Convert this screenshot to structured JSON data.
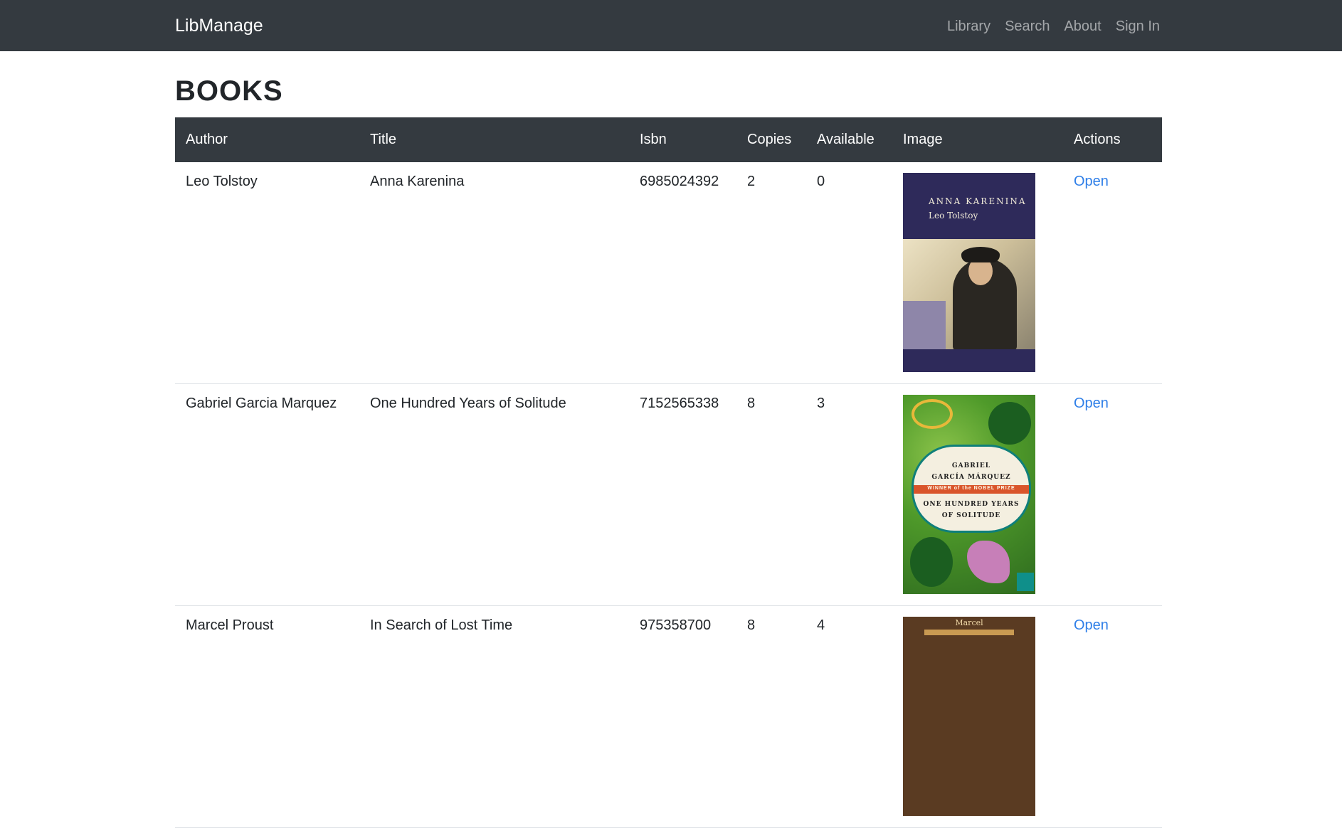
{
  "navbar": {
    "brand": "LibManage",
    "links": [
      "Library",
      "Search",
      "About",
      "Sign In"
    ]
  },
  "page": {
    "title": "BOOKS"
  },
  "table": {
    "headers": [
      "Author",
      "Title",
      "Isbn",
      "Copies",
      "Available",
      "Image",
      "Actions"
    ],
    "rows": [
      {
        "author": "Leo Tolstoy",
        "title": "Anna Karenina",
        "isbn": "6985024392",
        "copies": "2",
        "available": "0",
        "cover": {
          "title": "ANNA KARENINA",
          "author": "Leo Tolstoy"
        },
        "action": "Open"
      },
      {
        "author": "Gabriel Garcia Marquez",
        "title": "One Hundred Years of Solitude",
        "isbn": "7152565338",
        "copies": "8",
        "available": "3",
        "cover": {
          "line1": "GABRIEL",
          "line2": "GARCÍA MÁRQUEZ",
          "ribbon": "WINNER of the NOBEL PRIZE",
          "line3": "ONE HUNDRED YEARS",
          "line4": "OF SOLITUDE"
        },
        "action": "Open"
      },
      {
        "author": "Marcel Proust",
        "title": "In Search of Lost Time",
        "isbn": "975358700",
        "copies": "8",
        "available": "4",
        "cover": {
          "name": "Marcel"
        },
        "action": "Open"
      }
    ]
  },
  "colors": {
    "navbar": "#343a40",
    "link": "#2f7fe8"
  }
}
